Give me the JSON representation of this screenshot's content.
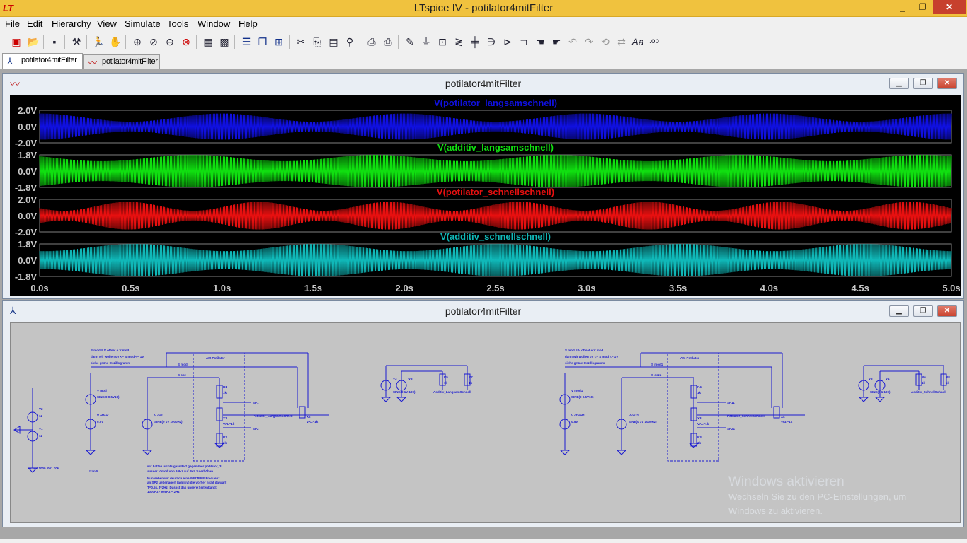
{
  "window": {
    "title": "LTspice IV - potilator4mitFilter",
    "minimize": "_",
    "maximize": "❐",
    "close": "✕"
  },
  "menu": [
    "File",
    "Edit",
    "Hierarchy",
    "View",
    "Simulate",
    "Tools",
    "Window",
    "Help"
  ],
  "tabs": [
    {
      "label": "potilator4mitFilter",
      "icon": "schematic-icon",
      "active": true
    },
    {
      "label": "potilator4mitFilter",
      "icon": "waveform-icon",
      "active": false
    }
  ],
  "plot_window": {
    "title": "potilator4mitFilter",
    "icon": "waveform-icon"
  },
  "schematic_window": {
    "title": "potilator4mitFilter",
    "icon": "schematic-icon"
  },
  "colors": {
    "trace1": "#1010e0",
    "trace2": "#10e010",
    "trace3": "#e81010",
    "trace4": "#10b8b8",
    "plot_bg": "#000000",
    "grid": "#808080",
    "axis_text": "#c8c8c8"
  },
  "chart_data": {
    "type": "line",
    "xlabel": "",
    "x_ticks": [
      "0.0s",
      "0.5s",
      "1.0s",
      "1.5s",
      "2.0s",
      "2.5s",
      "3.0s",
      "3.5s",
      "4.0s",
      "4.5s",
      "5.0s"
    ],
    "xlim": [
      0,
      5.0
    ],
    "panes": [
      {
        "name": "V(potilator_langsamschnell)",
        "y_ticks": [
          "2.0V",
          "0.0V",
          "-2.0V"
        ],
        "ylim": [
          -2.0,
          2.0
        ],
        "amplitude_range": [
          0.6,
          1.6
        ],
        "envelope_periods": 5,
        "color": "#1010e0"
      },
      {
        "name": "V(additiv_langsamschnell)",
        "y_ticks": [
          "1.8V",
          "0.0V",
          "-1.8V"
        ],
        "ylim": [
          -1.8,
          1.8
        ],
        "amplitude_range": [
          1.1,
          1.8
        ],
        "envelope_periods": 5,
        "color": "#10e010"
      },
      {
        "name": "V(potilator_schnellschnell)",
        "y_ticks": [
          "2.0V",
          "0.0V",
          "-2.0V"
        ],
        "ylim": [
          -2.0,
          2.0
        ],
        "amplitude_range": [
          0.6,
          1.7
        ],
        "envelope_periods": 7,
        "color": "#e81010"
      },
      {
        "name": "V(additiv_schnellschnell)",
        "y_ticks": [
          "1.8V",
          "0.0V",
          "-1.8V"
        ],
        "ylim": [
          -1.8,
          1.8
        ],
        "amplitude_range": [
          1.0,
          1.8
        ],
        "envelope_periods": 5,
        "color": "#10b8b8"
      }
    ]
  },
  "schematic": {
    "left": {
      "note": [
        "S mod = V offset + V mod",
        "dann wir wollen 0V <= S mod <= 1V",
        "siehe grüne Oszillogramm"
      ],
      "s_mod": "S mod",
      "s_osz": "S osz",
      "box": "AM-Potilator",
      "v_mod": "V mod",
      "v_mod_val": "SINE(0 0.5V10)",
      "v_offset": "V offset",
      "v_offset_val": "0.5V",
      "v_osz": "V osz",
      "v_osz_val": "SINE(0 1V 1000Hz)",
      "r1": "R1",
      "r1v": "1k",
      "x1": "X1",
      "x1v": "VAL=1k",
      "r3": "R3",
      "r3v": "1k",
      "sp1": "SP1",
      "sp2": "SP2",
      "label_pot": "Potilator_LangsamSchnell",
      "x2": "X2",
      "x2v": "VAL=1k",
      "v2": "V2",
      "v2v": "12",
      "v1": "V1",
      "v1v": "12",
      "tran": ".tran 5",
      "ac": ".ac oct 1000 .001 10k",
      "comment": [
        "wir hatten nichts geändert gegenüber potilator_3",
        "ausser V mod von 10Hz auf 0Hz zu erhöhen.",
        "Nun sehen wir deutlich eine WEITERE Frequenz",
        "an SP2 ueberlagert (additiv) die vorher nicht da war!",
        "T=0,5s, f=2Hz! Das ist das unsere Seitenband:",
        "1000Hz - 998Hz = 2Hz"
      ]
    },
    "mid": {
      "v3": "V3",
      "v3v": "SINE(0 1V 100)",
      "v6": "V6",
      "r5": "R5",
      "r5v": "1k",
      "r7": "R7",
      "r7v": "1k",
      "label": "Additiv_LangsamSchnell"
    },
    "right": {
      "note": [
        "S mod = V offset + V mod",
        "dann wir wollen 0V <= S mod <= 1V",
        "siehe grüne Oszillogramm"
      ],
      "s_mod": "S mod1",
      "s_osz": "S osz1",
      "box": "AM-Potilator",
      "v_mod": "V mod1",
      "v_mod_val": "SINE(0 0.5V10)",
      "v_offset": "V offset1",
      "v_offset_val": "0.5V",
      "v_osz": "V osz1",
      "v_osz_val": "SINE(0 1V 1000Hz)",
      "r1": "R4",
      "r1v": "1k",
      "x1": "X3",
      "x1v": "VAL=1k",
      "r3": "R3",
      "r3v": "1k",
      "sp1": "SP11",
      "sp2": "SP21",
      "label_pot": "Potilator_SchnellSchnell",
      "x2": "X4",
      "x2v": "VAL=1k"
    },
    "far": {
      "v5": "V5",
      "v4": "V4",
      "v4v": "SINE(0 1 100)",
      "r6": "R6",
      "r6v": "1k",
      "r8": "R8",
      "r8v": "1k",
      "label": "Additiv_SchnellSchnell"
    }
  },
  "watermark": {
    "title": "Windows aktivieren",
    "line1": "Wechseln Sie zu den PC-Einstellungen, um",
    "line2": "Windows zu aktivieren."
  }
}
